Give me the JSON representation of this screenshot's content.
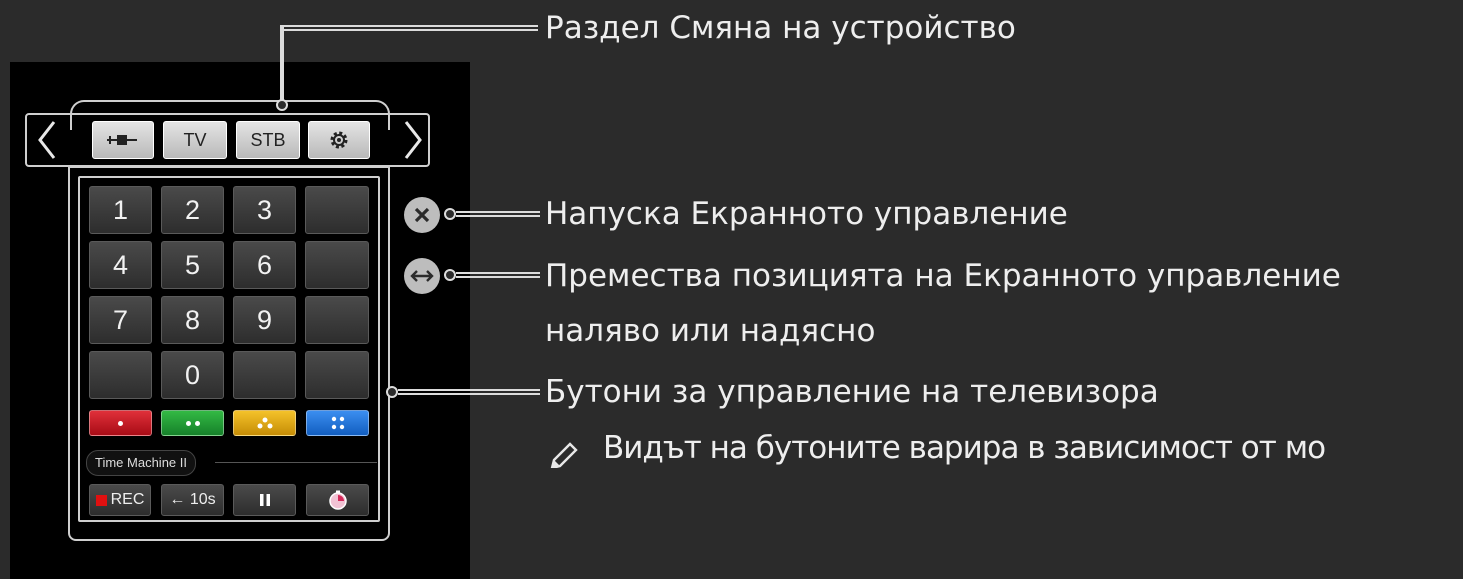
{
  "annotations": {
    "device_switch": "Раздел Смяна на устройство",
    "exit": "Напуска Екранното управление",
    "move_line1": "Премества позицията на Екранното управление",
    "move_line2": "наляво или надясно",
    "tv_buttons": "Бутони за управление на телевизора",
    "note": "Видът на бутоните варира в зависимост от мо"
  },
  "device_bar": {
    "prev_icon": "chevron-left-icon",
    "next_icon": "chevron-right-icon",
    "devices": [
      {
        "label": "",
        "icon": "external-input-icon"
      },
      {
        "label": "TV"
      },
      {
        "label": "STB"
      },
      {
        "label": "",
        "icon": "gear-icon"
      }
    ]
  },
  "keypad": {
    "rows": [
      [
        "1",
        "2",
        "3",
        ""
      ],
      [
        "4",
        "5",
        "6",
        ""
      ],
      [
        "7",
        "8",
        "9",
        ""
      ],
      [
        "",
        "0",
        "",
        ""
      ]
    ]
  },
  "color_keys": [
    {
      "name": "red",
      "color": "#c0101e"
    },
    {
      "name": "green",
      "color": "#1d9b2d"
    },
    {
      "name": "yellow",
      "color": "#e1a80a"
    },
    {
      "name": "blue",
      "color": "#1b6fd6"
    }
  ],
  "time_machine": {
    "label": "Time Machine II",
    "rec": "REC",
    "rewind": "← 10s",
    "pause_icon": "pause-icon",
    "timer_icon": "timer-icon"
  },
  "side_controls": {
    "exit_icon": "close-icon",
    "move_icon": "left-right-arrow-icon"
  }
}
